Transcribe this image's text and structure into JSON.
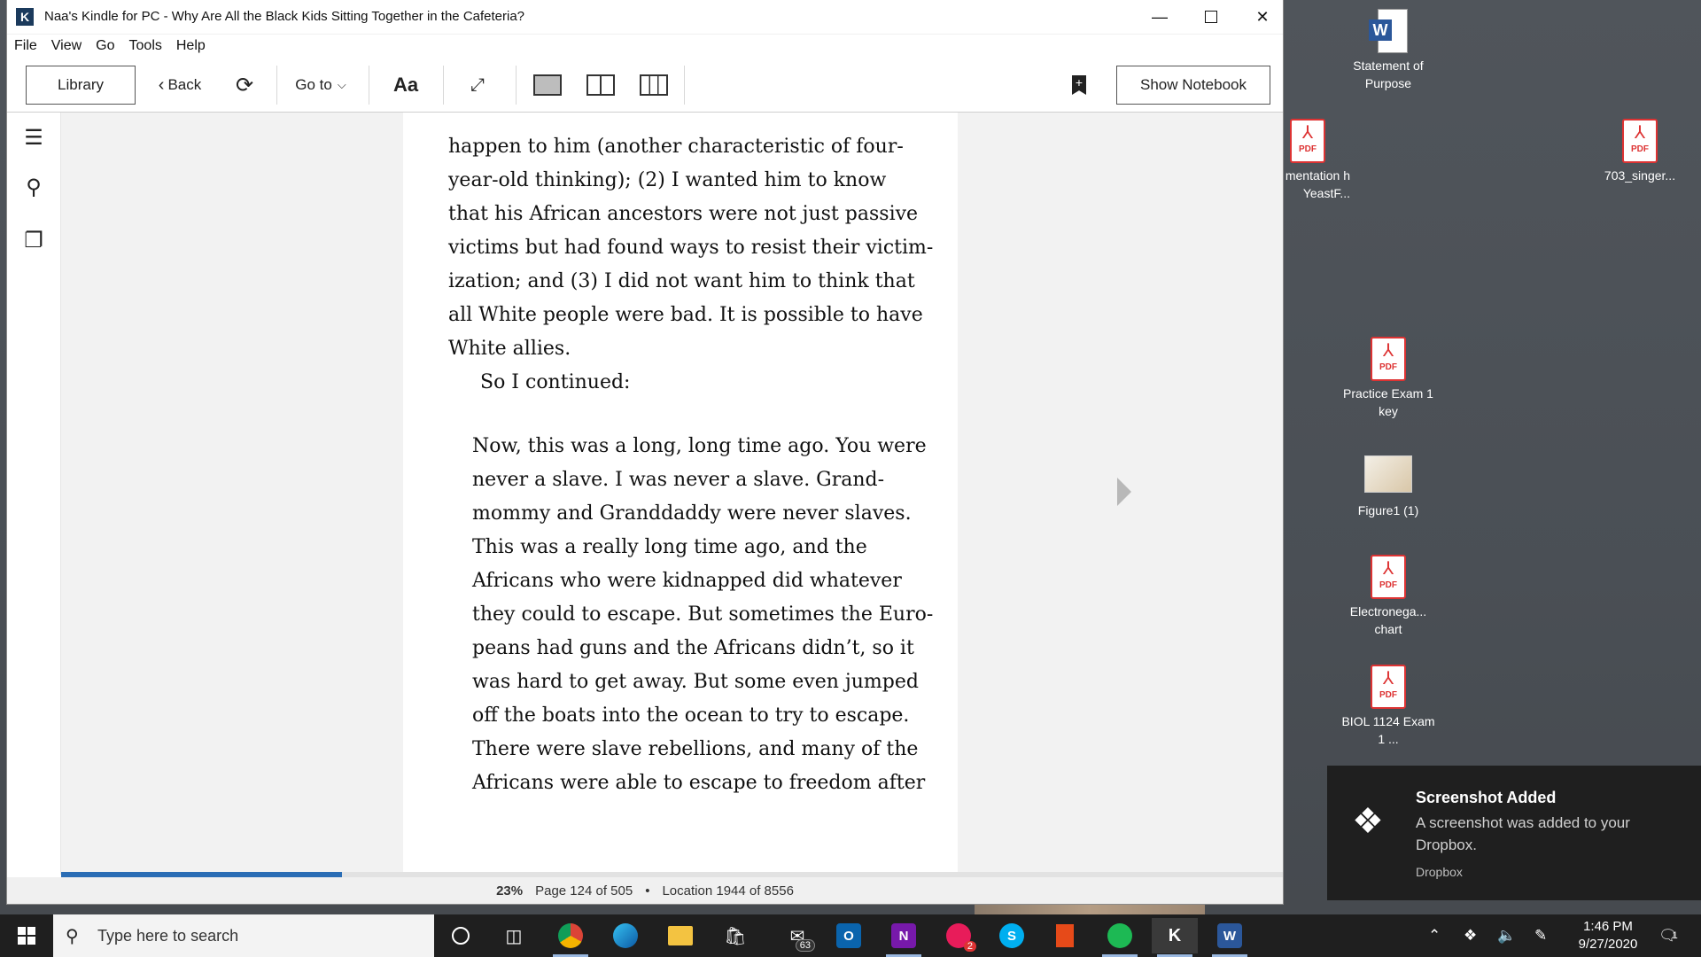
{
  "window": {
    "title": "Naa's Kindle for PC - Why Are All the Black Kids Sitting Together in the Cafeteria?",
    "app_icon": "K",
    "controls": [
      "minimize-icon",
      "maximize-icon",
      "close-icon"
    ]
  },
  "menu": [
    "File",
    "View",
    "Go",
    "Tools",
    "Help"
  ],
  "toolbar": {
    "library": "Library",
    "back": "Back",
    "goto": "Go to",
    "font": "Aa",
    "show_notebook": "Show Notebook"
  },
  "book": {
    "lines_main": [
      "happen to him (another characteristic of four-",
      "year-old thinking); (2) I wanted him to know",
      "that his African ancestors were not just passive",
      "victims but had found ways to resist their victim-",
      "ization; and (3) I did not want him to think that",
      "all White people were bad. It is possible to have",
      "White allies.",
      "So I continued:"
    ],
    "lines_quote": [
      "Now, this was a long, long time ago. You were",
      "never a slave. I was never a slave. Grand-",
      "mommy and Granddaddy were never slaves.",
      "This was a really long time ago, and the",
      "Africans who were kidnapped did whatever",
      "they could to escape. But sometimes the Euro-",
      "peans had guns and the Africans didn’t, so it",
      "was hard to get away. But some even jumped",
      "off the boats into the ocean to try to escape.",
      "There were slave rebellions, and many of the",
      "Africans were able to escape to freedom after"
    ]
  },
  "status": {
    "percent": "23%",
    "percent_value": 0.23,
    "page": "Page 124 of 505",
    "bullet": "•",
    "location": "Location 1944 of 8556"
  },
  "desktop_icons": [
    {
      "type": "word",
      "label": "Statement of Purpose"
    },
    {
      "type": "pdf",
      "label": "mentation h YeastF..."
    },
    {
      "type": "pdf",
      "label": "703_singer..."
    },
    {
      "type": "pdf",
      "label": "Practice Exam 1 key"
    },
    {
      "type": "image",
      "label": "Figure1 (1)"
    },
    {
      "type": "pdf",
      "label": "Electronega... chart"
    },
    {
      "type": "pdf",
      "label": "BIOL 1124 Exam 1 ..."
    }
  ],
  "pdf_badge": "PDF",
  "toast": {
    "title": "Screenshot Added",
    "body": "A screenshot was added to your Dropbox.",
    "app": "Dropbox"
  },
  "taskbar": {
    "search_placeholder": "Type here to search",
    "mail_badge": "63",
    "app2_badge": "2",
    "time": "1:46 PM",
    "date": "9/27/2020",
    "notifications": "1"
  },
  "colors": {
    "progress": "#2a6db5",
    "toast_bg": "#1f1f1f",
    "taskbar_bg": "#1f1f1f"
  }
}
